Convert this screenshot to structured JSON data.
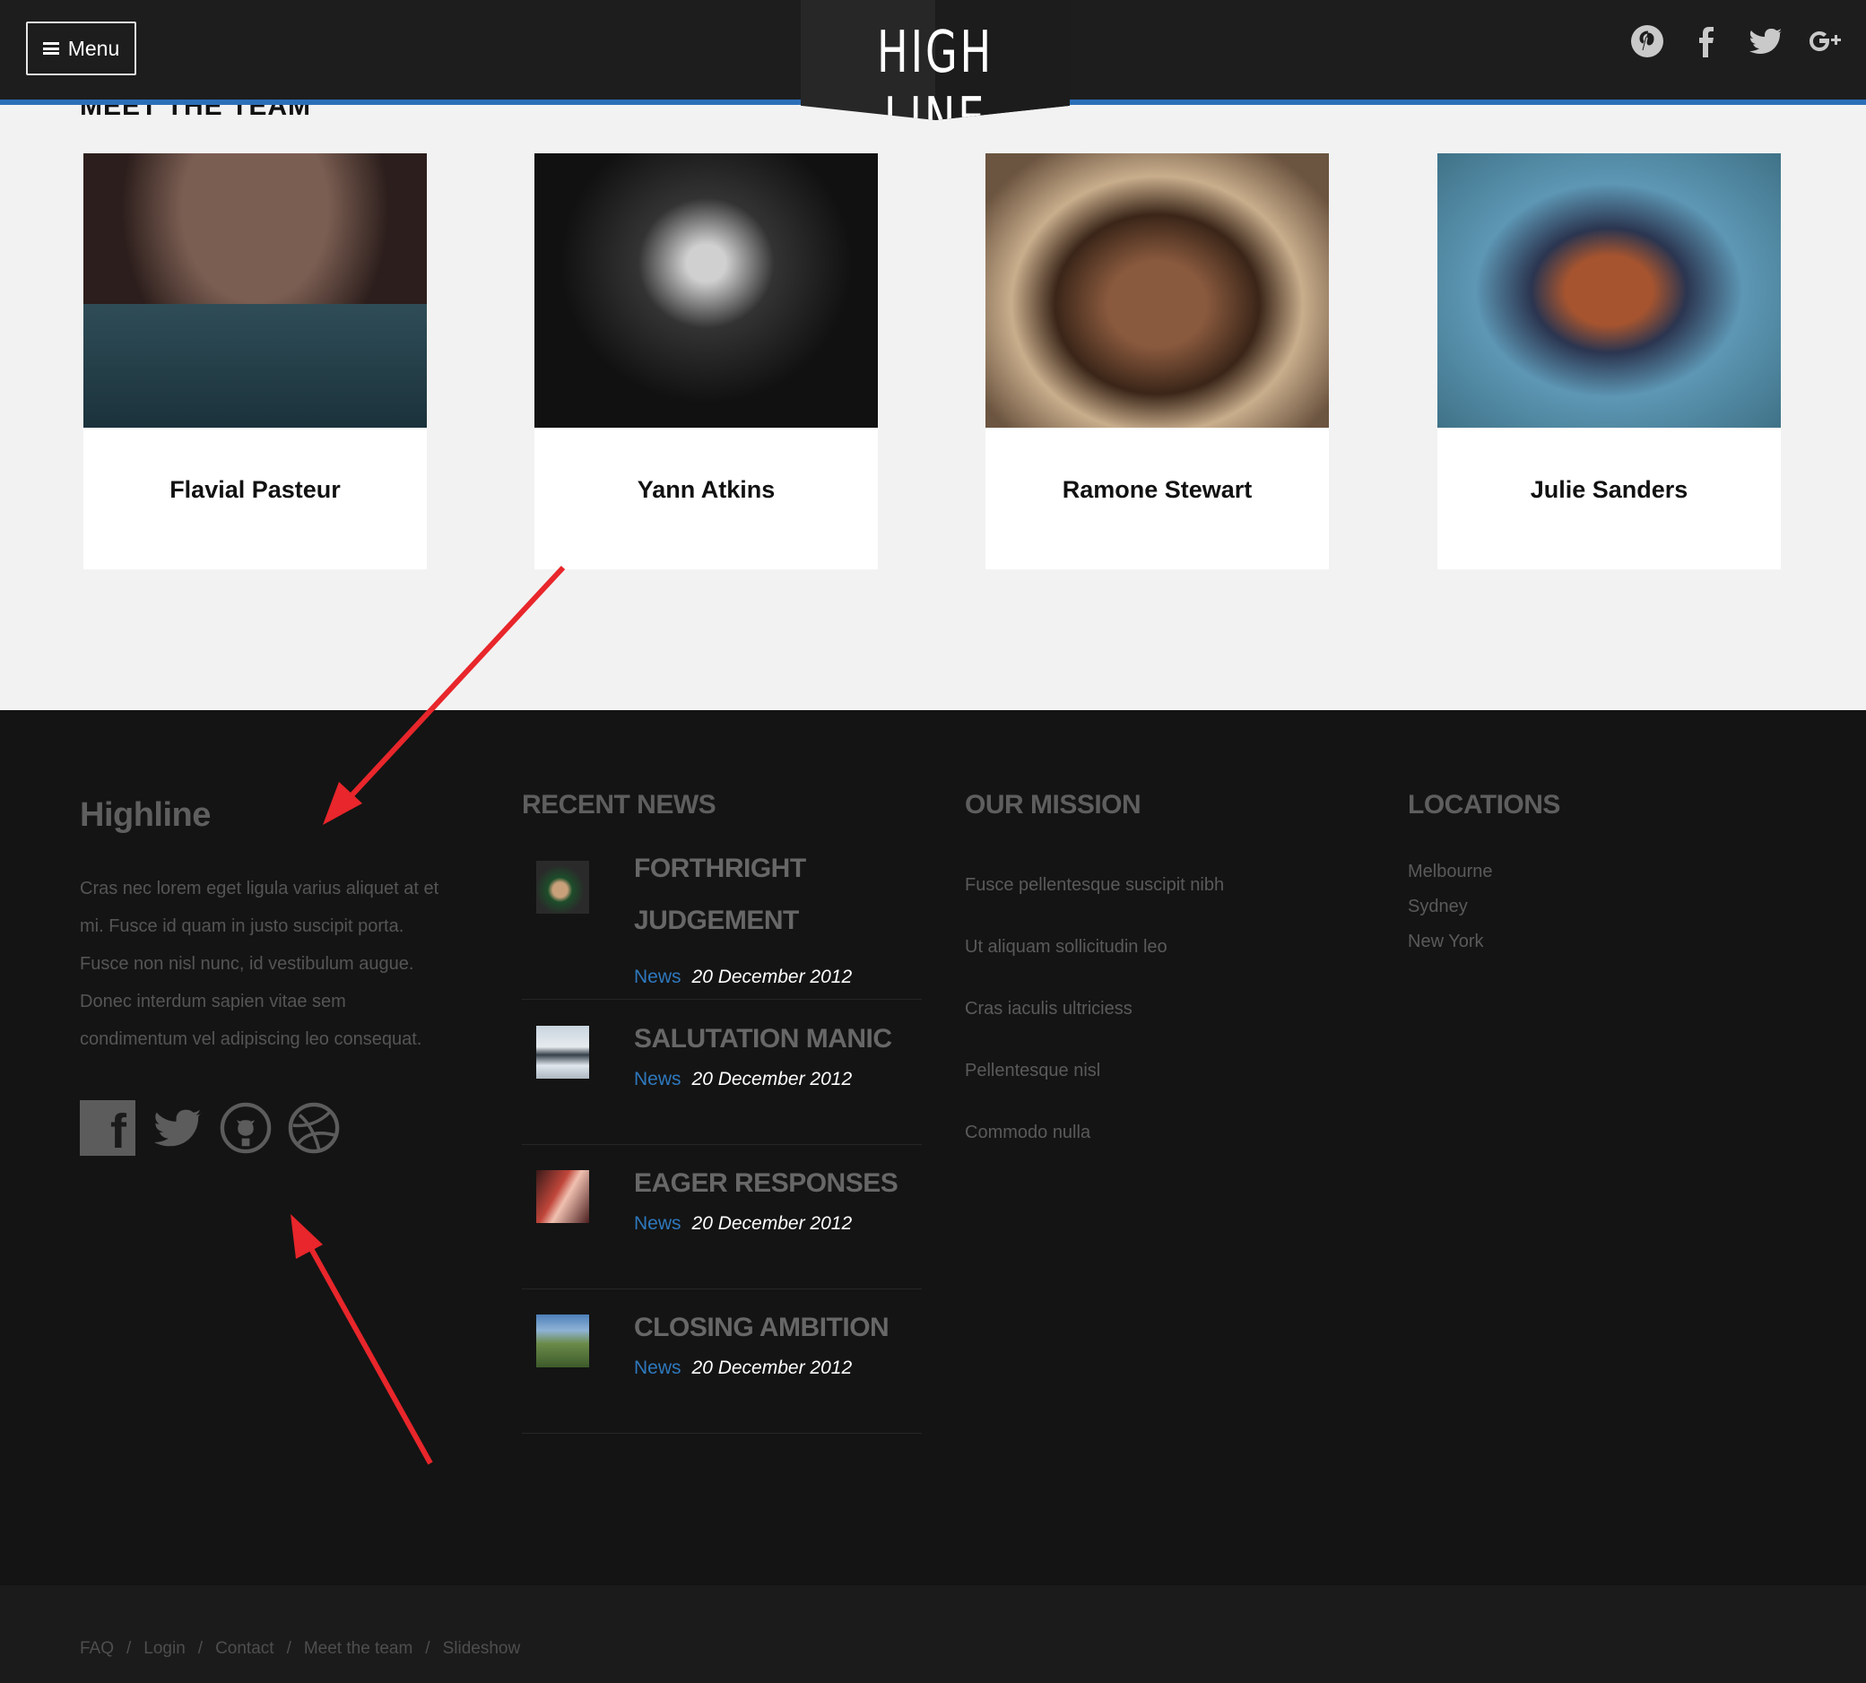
{
  "header": {
    "menu_label": "Menu",
    "logo": "HIGH LINE",
    "social": [
      "pinterest-icon",
      "facebook-icon",
      "twitter-icon",
      "google-plus-icon"
    ]
  },
  "team": {
    "heading": "MEET THE TEAM",
    "members": [
      {
        "name": "Flavial Pasteur"
      },
      {
        "name": "Yann Atkins"
      },
      {
        "name": "Ramone Stewart"
      },
      {
        "name": "Julie Sanders"
      }
    ]
  },
  "footer": {
    "brand": "Highline",
    "about": "Cras nec lorem eget ligula varius aliquet at et mi. Fusce id quam in justo suscipit porta. Fusce non nisl nunc, id vestibulum augue. Donec interdum sapien vitae sem condimentum vel adipiscing leo consequat.",
    "social": [
      "facebook-icon",
      "twitter-icon",
      "github-icon",
      "dribbble-icon"
    ],
    "recent_news": {
      "title": "RECENT NEWS",
      "items": [
        {
          "title": "FORTHRIGHT JUDGEMENT",
          "category": "News",
          "date": "20 December 2012"
        },
        {
          "title": "SALUTATION MANIC",
          "category": "News",
          "date": "20 December 2012"
        },
        {
          "title": "EAGER RESPONSES",
          "category": "News",
          "date": "20 December 2012"
        },
        {
          "title": "CLOSING AMBITION",
          "category": "News",
          "date": "20 December 2012"
        }
      ]
    },
    "mission": {
      "title": "OUR MISSION",
      "items": [
        "Fusce pellentesque suscipit nibh",
        "Ut aliquam sollicitudin leo",
        "Cras iaculis ultriciess",
        "Pellentesque nisl",
        "Commodo nulla"
      ]
    },
    "locations": {
      "title": "LOCATIONS",
      "items": [
        "Melbourne",
        "Sydney",
        "New York"
      ]
    },
    "bottom_links": [
      "FAQ",
      "Login",
      "Contact",
      "Meet the team",
      "Slideshow"
    ]
  },
  "colors": {
    "accent": "#2b6fb8",
    "annotation_arrow": "#e8262b"
  }
}
